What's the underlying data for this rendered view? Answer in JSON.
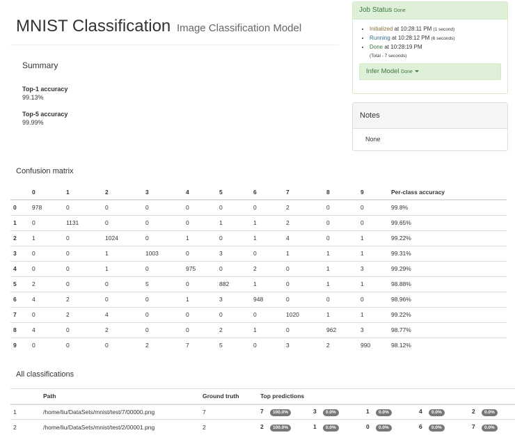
{
  "header": {
    "title": "MNIST Classification",
    "subtitle": "Image Classification Model"
  },
  "summary": {
    "heading": "Summary",
    "top1_label": "Top-1 accuracy",
    "top1_value": "99.13%",
    "top5_label": "Top-5 accuracy",
    "top5_value": "99.99%"
  },
  "job_status": {
    "title": "Job Status",
    "status": "Done",
    "steps": [
      {
        "name": "Initialized",
        "time": "at 10:28:11 PM",
        "dur": "(1 second)"
      },
      {
        "name": "Running",
        "time": "at 10:28:12 PM",
        "dur": "(6 seconds)"
      },
      {
        "name": "Done",
        "time": "at 10:28:19 PM",
        "dur": ""
      }
    ],
    "total": "(Total - 7 seconds)",
    "infer_label": "Infer Model",
    "infer_status": "Done"
  },
  "notes": {
    "title": "Notes",
    "body": "None"
  },
  "confusion": {
    "heading": "Confusion matrix",
    "headers": [
      "",
      "0",
      "1",
      "2",
      "3",
      "4",
      "5",
      "6",
      "7",
      "8",
      "9",
      "Per-class accuracy"
    ],
    "rows": [
      [
        "0",
        "978",
        "0",
        "0",
        "0",
        "0",
        "0",
        "0",
        "2",
        "0",
        "0",
        "99.8%"
      ],
      [
        "1",
        "0",
        "1131",
        "0",
        "0",
        "0",
        "1",
        "1",
        "2",
        "0",
        "0",
        "99.65%"
      ],
      [
        "2",
        "1",
        "0",
        "1024",
        "0",
        "1",
        "0",
        "1",
        "4",
        "0",
        "1",
        "99.22%"
      ],
      [
        "3",
        "0",
        "0",
        "1",
        "1003",
        "0",
        "3",
        "0",
        "1",
        "1",
        "1",
        "99.31%"
      ],
      [
        "4",
        "0",
        "0",
        "1",
        "0",
        "975",
        "0",
        "2",
        "0",
        "1",
        "3",
        "99.29%"
      ],
      [
        "5",
        "2",
        "0",
        "0",
        "5",
        "0",
        "882",
        "1",
        "0",
        "1",
        "1",
        "98.88%"
      ],
      [
        "6",
        "4",
        "2",
        "0",
        "0",
        "1",
        "3",
        "948",
        "0",
        "0",
        "0",
        "98.96%"
      ],
      [
        "7",
        "0",
        "2",
        "4",
        "0",
        "0",
        "0",
        "0",
        "1020",
        "1",
        "1",
        "99.22%"
      ],
      [
        "8",
        "4",
        "0",
        "2",
        "0",
        "0",
        "2",
        "1",
        "0",
        "962",
        "3",
        "98.77%"
      ],
      [
        "9",
        "0",
        "0",
        "0",
        "2",
        "7",
        "5",
        "0",
        "3",
        "2",
        "990",
        "98.12%"
      ]
    ]
  },
  "classifications": {
    "heading": "All classifications",
    "headers": [
      "",
      "Path",
      "Ground truth",
      "Top predictions"
    ],
    "rows": [
      {
        "index": "1",
        "path": "/home/liu/DataSets/mnist/test/7/00000.png",
        "truth": "7",
        "preds": [
          [
            "7",
            "100.0%"
          ],
          [
            "3",
            "0.0%"
          ],
          [
            "1",
            "0.0%"
          ],
          [
            "4",
            "0.0%"
          ],
          [
            "2",
            "0.0%"
          ]
        ]
      },
      {
        "index": "2",
        "path": "/home/liu/DataSets/mnist/test/2/00001.png",
        "truth": "2",
        "preds": [
          [
            "2",
            "100.0%"
          ],
          [
            "1",
            "0.0%"
          ],
          [
            "0",
            "0.0%"
          ],
          [
            "6",
            "0.0%"
          ],
          [
            "7",
            "0.0%"
          ]
        ]
      }
    ]
  }
}
